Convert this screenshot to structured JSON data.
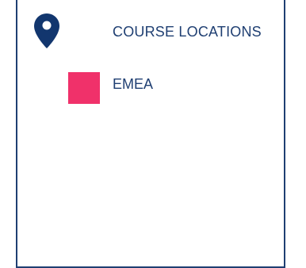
{
  "panel": {
    "title": "COURSE LOCATIONS",
    "icon": "map-pin-icon",
    "colors": {
      "primary": "#1f3f72",
      "background": "#ffffff"
    },
    "legend": [
      {
        "label": "EMEA",
        "color": "#f0316a"
      }
    ]
  }
}
